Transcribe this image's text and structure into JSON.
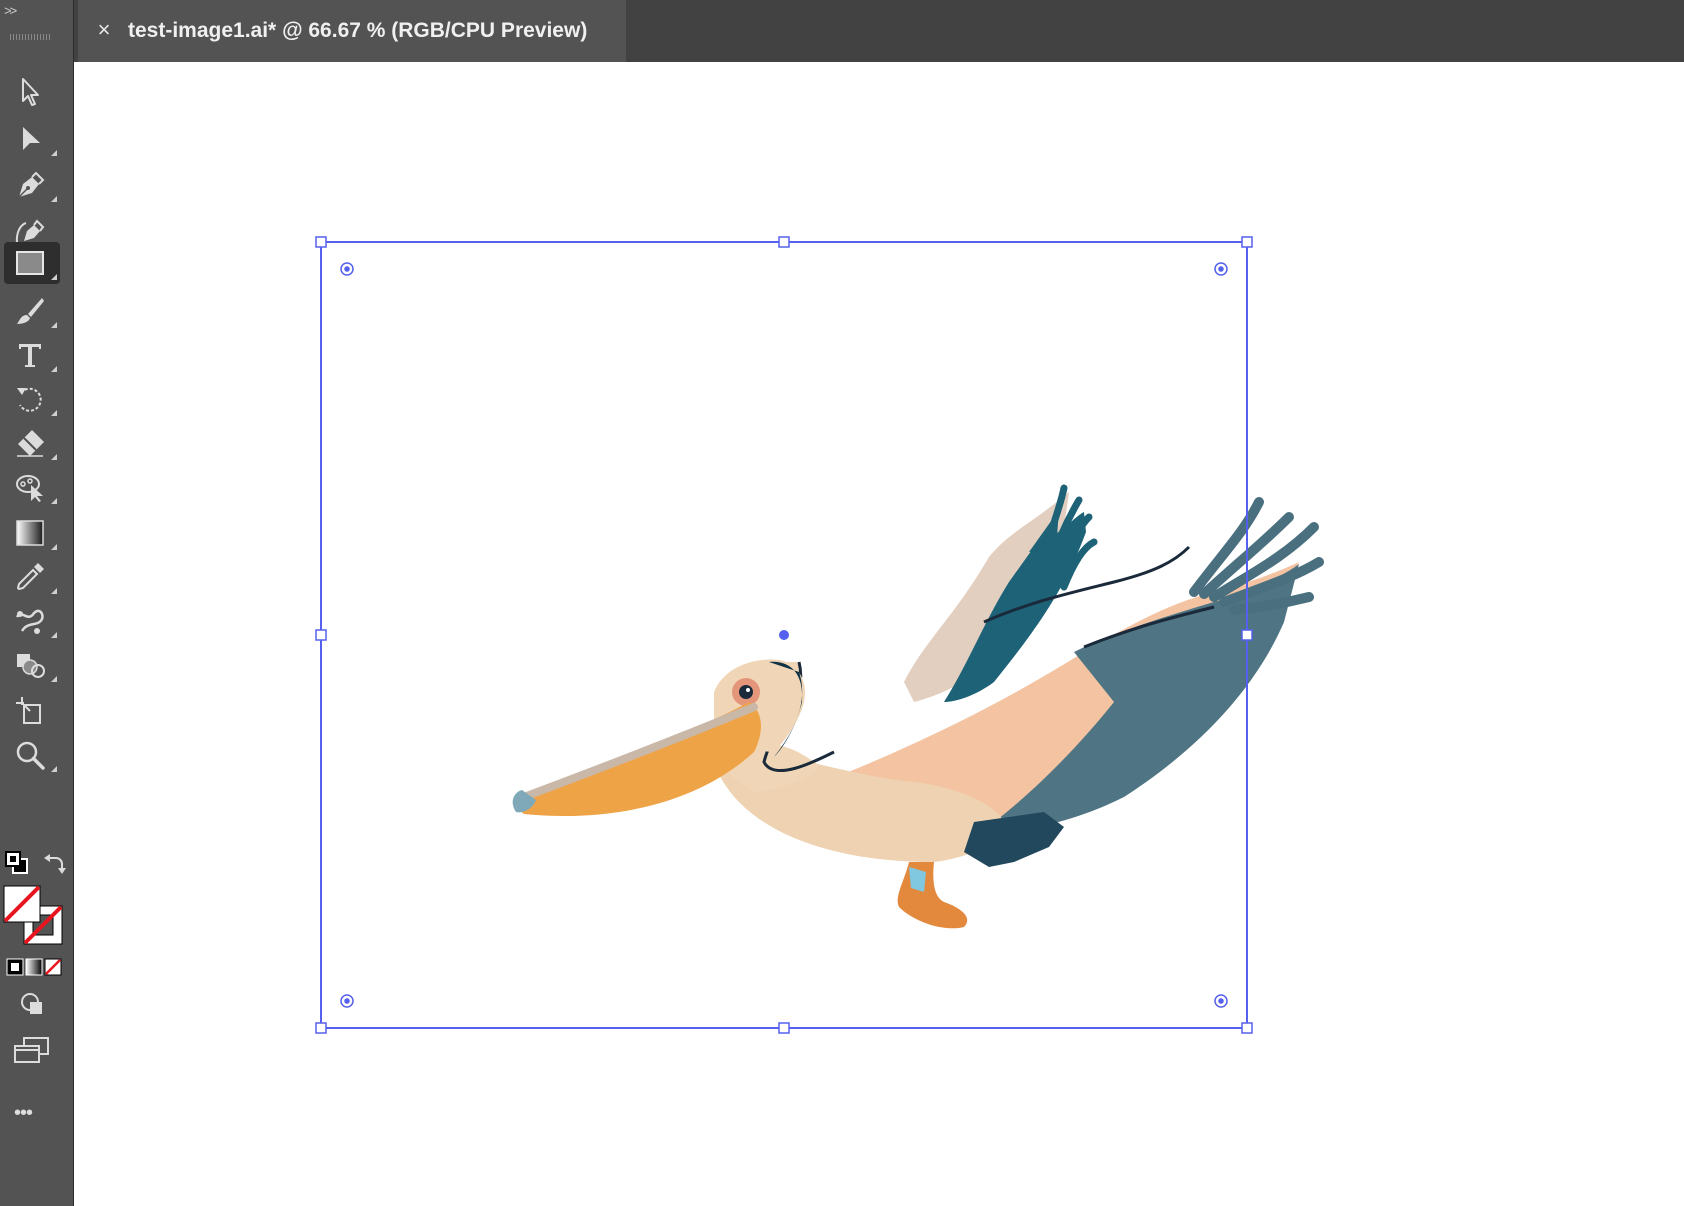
{
  "app": "Adobe Illustrator",
  "document_tab": {
    "close_glyph": "×",
    "title": "test-image1.ai* @ 66.67 % (RGB/CPU Preview)"
  },
  "toolbar": {
    "collapse_glyph": ">>",
    "more_glyph": "•••",
    "tools": [
      {
        "name": "selection-tool",
        "icon": "selection-arrow-icon"
      },
      {
        "name": "direct-selection-tool",
        "icon": "direct-selection-arrow-icon"
      },
      {
        "name": "pen-tool",
        "icon": "pen-icon"
      },
      {
        "name": "curvature-tool",
        "icon": "curvature-pen-icon"
      },
      {
        "name": "rectangle-tool",
        "icon": "rectangle-icon",
        "active": true
      },
      {
        "name": "paintbrush-tool",
        "icon": "brush-icon"
      },
      {
        "name": "type-tool",
        "icon": "type-icon"
      },
      {
        "name": "rotate-tool",
        "icon": "rotate-icon"
      },
      {
        "name": "eraser-tool",
        "icon": "eraser-icon"
      },
      {
        "name": "puppet-warp-tool",
        "icon": "puppet-warp-icon"
      },
      {
        "name": "gradient-tool",
        "icon": "gradient-icon"
      },
      {
        "name": "eyedropper-tool",
        "icon": "eyedropper-icon"
      },
      {
        "name": "blend-tool",
        "icon": "blend-icon"
      },
      {
        "name": "shape-builder-tool",
        "icon": "shape-builder-icon"
      },
      {
        "name": "artboard-tool",
        "icon": "artboard-icon"
      },
      {
        "name": "zoom-tool",
        "icon": "zoom-icon"
      }
    ]
  },
  "colors": {
    "selection": "#5560ee",
    "toolbar_bg": "#535353",
    "tabbar_bg": "#424242",
    "fill_none_slash": "#e8141e"
  }
}
